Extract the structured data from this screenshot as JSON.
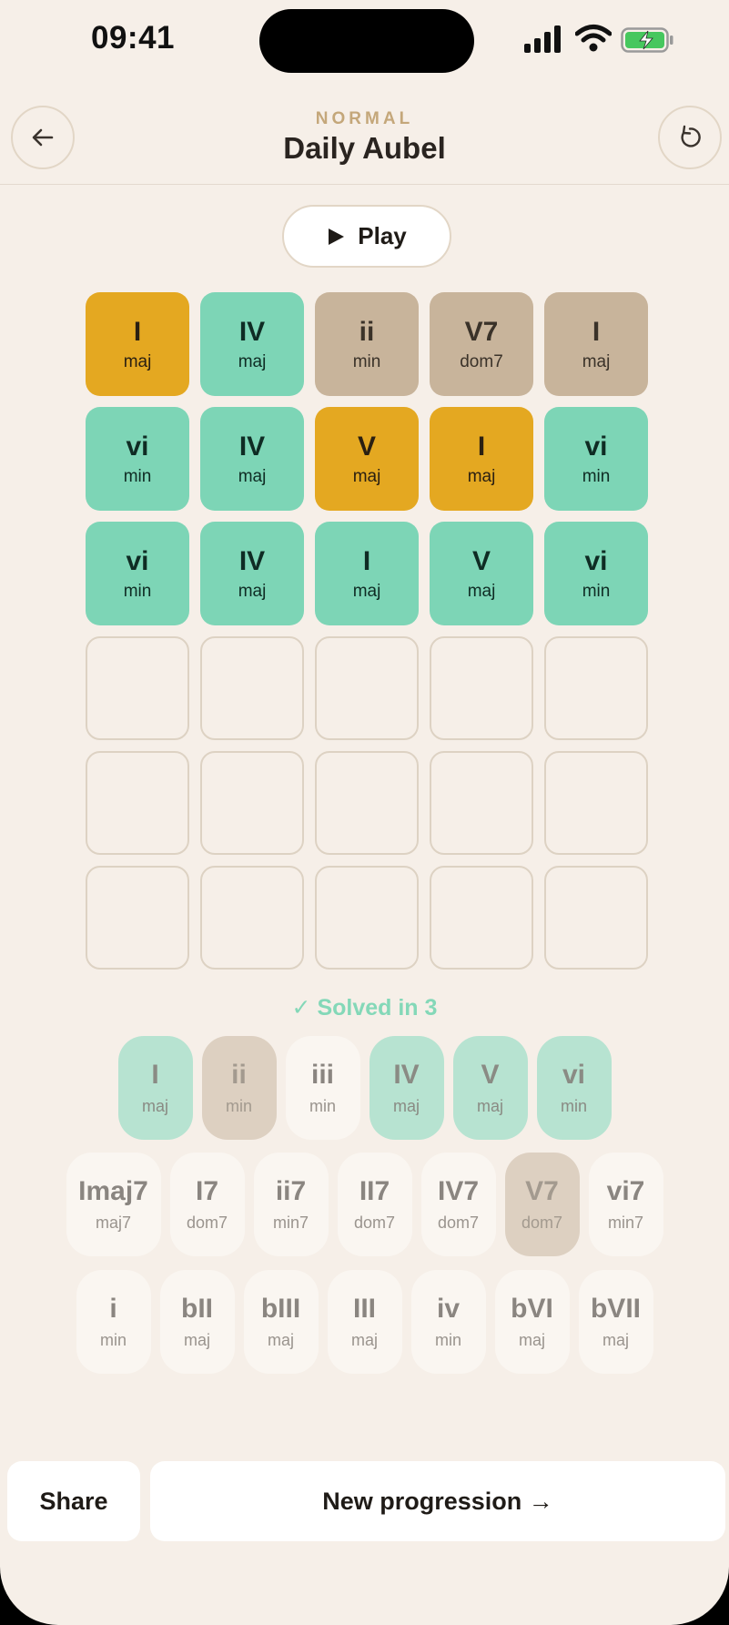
{
  "status_bar": {
    "time": "09:41"
  },
  "header": {
    "mode": "NORMAL",
    "title": "Daily Aubel"
  },
  "play_button": {
    "label": "Play"
  },
  "guesses": [
    [
      {
        "numeral": "I",
        "quality": "maj",
        "state": "yellow"
      },
      {
        "numeral": "IV",
        "quality": "maj",
        "state": "green"
      },
      {
        "numeral": "ii",
        "quality": "min",
        "state": "tan"
      },
      {
        "numeral": "V7",
        "quality": "dom7",
        "state": "tan"
      },
      {
        "numeral": "I",
        "quality": "maj",
        "state": "tan"
      }
    ],
    [
      {
        "numeral": "vi",
        "quality": "min",
        "state": "green"
      },
      {
        "numeral": "IV",
        "quality": "maj",
        "state": "green"
      },
      {
        "numeral": "V",
        "quality": "maj",
        "state": "yellow"
      },
      {
        "numeral": "I",
        "quality": "maj",
        "state": "yellow"
      },
      {
        "numeral": "vi",
        "quality": "min",
        "state": "green"
      }
    ],
    [
      {
        "numeral": "vi",
        "quality": "min",
        "state": "green"
      },
      {
        "numeral": "IV",
        "quality": "maj",
        "state": "green"
      },
      {
        "numeral": "I",
        "quality": "maj",
        "state": "green"
      },
      {
        "numeral": "V",
        "quality": "maj",
        "state": "green"
      },
      {
        "numeral": "vi",
        "quality": "min",
        "state": "green"
      }
    ]
  ],
  "empty_rows": 3,
  "columns": 5,
  "status_message": "✓ Solved in 3",
  "keyboard": {
    "row1": [
      {
        "numeral": "I",
        "quality": "maj",
        "state": "green"
      },
      {
        "numeral": "ii",
        "quality": "min",
        "state": "tan"
      },
      {
        "numeral": "iii",
        "quality": "min",
        "state": "plain"
      },
      {
        "numeral": "IV",
        "quality": "maj",
        "state": "green"
      },
      {
        "numeral": "V",
        "quality": "maj",
        "state": "green"
      },
      {
        "numeral": "vi",
        "quality": "min",
        "state": "green"
      }
    ],
    "row2": [
      {
        "numeral": "Imaj7",
        "quality": "maj7",
        "state": "plain",
        "wide": true
      },
      {
        "numeral": "I7",
        "quality": "dom7",
        "state": "plain"
      },
      {
        "numeral": "ii7",
        "quality": "min7",
        "state": "plain"
      },
      {
        "numeral": "II7",
        "quality": "dom7",
        "state": "plain"
      },
      {
        "numeral": "IV7",
        "quality": "dom7",
        "state": "plain"
      },
      {
        "numeral": "V7",
        "quality": "dom7",
        "state": "tan"
      },
      {
        "numeral": "vi7",
        "quality": "min7",
        "state": "plain"
      }
    ],
    "row3": [
      {
        "numeral": "i",
        "quality": "min",
        "state": "plain"
      },
      {
        "numeral": "bII",
        "quality": "maj",
        "state": "plain"
      },
      {
        "numeral": "bIII",
        "quality": "maj",
        "state": "plain"
      },
      {
        "numeral": "III",
        "quality": "maj",
        "state": "plain"
      },
      {
        "numeral": "iv",
        "quality": "min",
        "state": "plain"
      },
      {
        "numeral": "bVI",
        "quality": "maj",
        "state": "plain"
      },
      {
        "numeral": "bVII",
        "quality": "maj",
        "state": "plain"
      }
    ]
  },
  "footer": {
    "share_label": "Share",
    "new_label": "New progression →"
  },
  "colors": {
    "yellow": "#e4a821",
    "green": "#7dd5b6",
    "tan": "#c8b49b",
    "background": "#f6efe8",
    "accent_mode": "#c4a77a"
  }
}
